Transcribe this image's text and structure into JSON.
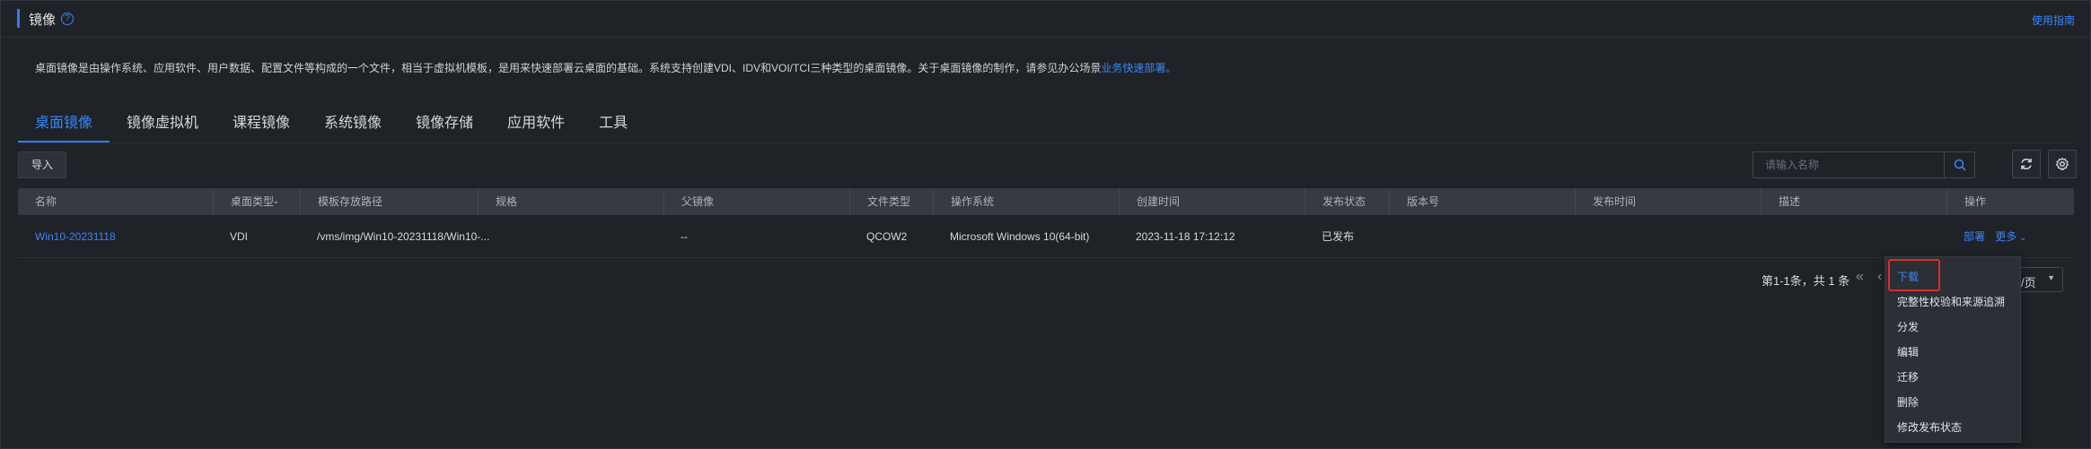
{
  "header": {
    "title": "镜像",
    "guide_link": "使用指南",
    "description_text": "桌面镜像是由操作系统、应用软件、用户数据、配置文件等构成的一个文件，相当于虚拟机模板，是用来快速部署云桌面的基础。系统支持创建VDI、IDV和VOI/TCI三种类型的桌面镜像。关于桌面镜像的制作，请参见办公场景",
    "description_link": "业务快速部署。"
  },
  "tabs": [
    {
      "label": "桌面镜像",
      "active": true
    },
    {
      "label": "镜像虚拟机",
      "active": false
    },
    {
      "label": "课程镜像",
      "active": false
    },
    {
      "label": "系统镜像",
      "active": false
    },
    {
      "label": "镜像存储",
      "active": false
    },
    {
      "label": "应用软件",
      "active": false
    },
    {
      "label": "工具",
      "active": false
    }
  ],
  "toolbar": {
    "import_label": "导入",
    "search_placeholder": "请输入名称"
  },
  "table": {
    "columns": [
      "名称",
      "桌面类型",
      "模板存放路径",
      "规格",
      "父镜像",
      "文件类型",
      "操作系统",
      "创建时间",
      "发布状态",
      "版本号",
      "发布时间",
      "描述",
      "操作"
    ],
    "rows": [
      {
        "name": "Win10-20231118",
        "desktop_type": "VDI",
        "path": "/vms/img/Win10-20231118/Win10-...",
        "spec": "",
        "parent_image": "--",
        "file_type": "QCOW2",
        "os": "Microsoft Windows 10(64-bit)",
        "created": "2023-11-18 17:12:12",
        "publish_status": "已发布",
        "version": "",
        "publish_time": "",
        "desc": "",
        "action_deploy": "部署",
        "action_more": "更多"
      }
    ]
  },
  "pagination": {
    "summary": "第1-1条，共 1 条",
    "page_size_suffix": "/页"
  },
  "more_menu": {
    "items": [
      "下载",
      "完整性校验和来源追溯",
      "分发",
      "编辑",
      "迁移",
      "删除",
      "修改发布状态"
    ],
    "highlighted_index": 0
  },
  "colors": {
    "accent": "#2f7cf6",
    "background": "#1f2227",
    "header_row": "#353a43",
    "highlight_box": "#e02b2b"
  }
}
